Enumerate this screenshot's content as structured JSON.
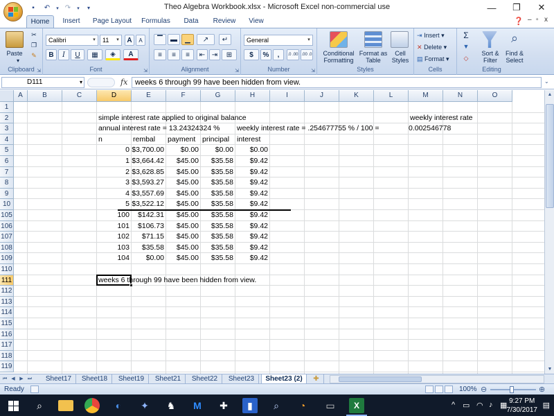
{
  "window": {
    "title": "Theo Algebra Workbook.xlsx - Microsoft Excel non-commercial use"
  },
  "ribbon_tabs": [
    "Home",
    "Insert",
    "Page Layout",
    "Formulas",
    "Data",
    "Review",
    "View"
  ],
  "ribbon": {
    "clipboard": {
      "label": "Clipboard",
      "paste": "Paste"
    },
    "font": {
      "label": "Font",
      "name": "Calibri",
      "size": "11"
    },
    "alignment": {
      "label": "Alignment"
    },
    "number": {
      "label": "Number",
      "format": "General",
      "currency": "$",
      "percent": "%",
      "comma": ",",
      "inc_dec": ".0 .00",
      "dec_dec": ".00 .0"
    },
    "styles": {
      "label": "Styles",
      "conditional": "Conditional Formatting",
      "format_table": "Format as Table",
      "cell_styles": "Cell Styles"
    },
    "cells": {
      "label": "Cells",
      "insert": "Insert",
      "delete": "Delete",
      "format": "Format"
    },
    "editing": {
      "label": "Editing",
      "sort": "Sort & Filter",
      "find": "Find & Select"
    }
  },
  "formula_bar": {
    "name_box": "D111",
    "fx": "fx",
    "content": "weeks 6 through 99 have been hidden from view."
  },
  "columns": [
    "A",
    "B",
    "C",
    "D",
    "E",
    "F",
    "G",
    "H",
    "I",
    "J",
    "K",
    "L",
    "M",
    "N",
    "O"
  ],
  "rows": [
    "1",
    "2",
    "3",
    "4",
    "5",
    "6",
    "7",
    "8",
    "9",
    "10",
    "105",
    "106",
    "107",
    "108",
    "109",
    "110",
    "111",
    "112",
    "113",
    "114",
    "115",
    "116",
    "117",
    "118",
    "119"
  ],
  "cells": {
    "d2": "simple interest rate applied to original balance",
    "m2": "weekly interest rate",
    "d3": "annual interest rate = 13.24324324 %",
    "h3": "weekly interest rate = .254677755 % / 100 =",
    "m3": "0.002546778",
    "d4": "n",
    "e4": "rembal",
    "f4": "payment",
    "g4": "principal",
    "h4": "interest",
    "d111": "weeks 6 through 99 have been hidden from view."
  },
  "table_rows": [
    {
      "n": "0",
      "rembal": "$3,700.00",
      "payment": "$0.00",
      "principal": "$0.00",
      "interest": "$0.00"
    },
    {
      "n": "1",
      "rembal": "$3,664.42",
      "payment": "$45.00",
      "principal": "$35.58",
      "interest": "$9.42"
    },
    {
      "n": "2",
      "rembal": "$3,628.85",
      "payment": "$45.00",
      "principal": "$35.58",
      "interest": "$9.42"
    },
    {
      "n": "3",
      "rembal": "$3,593.27",
      "payment": "$45.00",
      "principal": "$35.58",
      "interest": "$9.42"
    },
    {
      "n": "4",
      "rembal": "$3,557.69",
      "payment": "$45.00",
      "principal": "$35.58",
      "interest": "$9.42"
    },
    {
      "n": "5",
      "rembal": "$3,522.12",
      "payment": "$45.00",
      "principal": "$35.58",
      "interest": "$9.42"
    },
    {
      "n": "100",
      "rembal": "$142.31",
      "payment": "$45.00",
      "principal": "$35.58",
      "interest": "$9.42"
    },
    {
      "n": "101",
      "rembal": "$106.73",
      "payment": "$45.00",
      "principal": "$35.58",
      "interest": "$9.42"
    },
    {
      "n": "102",
      "rembal": "$71.15",
      "payment": "$45.00",
      "principal": "$35.58",
      "interest": "$9.42"
    },
    {
      "n": "103",
      "rembal": "$35.58",
      "payment": "$45.00",
      "principal": "$35.58",
      "interest": "$9.42"
    },
    {
      "n": "104",
      "rembal": "$0.00",
      "payment": "$45.00",
      "principal": "$35.58",
      "interest": "$9.42"
    }
  ],
  "sheet_tabs": [
    "Sheet17",
    "Sheet18",
    "Sheet19",
    "Sheet21",
    "Sheet22",
    "Sheet23",
    "Sheet23 (2)"
  ],
  "active_sheet": "Sheet23 (2)",
  "status": {
    "ready": "Ready",
    "zoom": "100%"
  },
  "clock": {
    "time": "9:27 PM",
    "date": "7/30/2017"
  },
  "colors": {
    "accent": "#2b63b0",
    "ribbon": "#d2def0",
    "taskbar": "#101a2a",
    "selection": "#f7c96a"
  }
}
